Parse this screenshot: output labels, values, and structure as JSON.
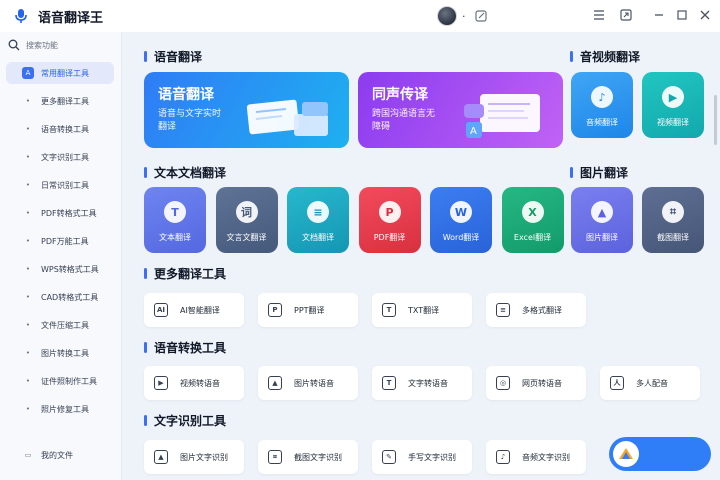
{
  "app": {
    "title": "语音翻译王",
    "user_name": "."
  },
  "sidebar": {
    "search_placeholder": "搜索功能",
    "items": [
      {
        "label": "常用翻译工具",
        "icon": "translate-icon"
      },
      {
        "label": "更多翻译工具",
        "icon": "more-translate-icon"
      },
      {
        "label": "语音转换工具",
        "icon": "voice-icon"
      },
      {
        "label": "文字识别工具",
        "icon": "text-recognition-icon"
      },
      {
        "label": "日常识别工具",
        "icon": "daily-recognition-icon"
      },
      {
        "label": "PDF转格式工具",
        "icon": "pdf-convert-icon"
      },
      {
        "label": "PDF万能工具",
        "icon": "pdf-tools-icon"
      },
      {
        "label": "WPS转格式工具",
        "icon": "wps-icon"
      },
      {
        "label": "CAD转格式工具",
        "icon": "cad-icon"
      },
      {
        "label": "文件压缩工具",
        "icon": "compress-icon"
      },
      {
        "label": "图片转换工具",
        "icon": "image-convert-icon"
      },
      {
        "label": "证件照制作工具",
        "icon": "id-photo-icon"
      },
      {
        "label": "照片修复工具",
        "icon": "photo-repair-icon"
      }
    ],
    "my_files": "我的文件"
  },
  "sections": {
    "voice_translate": "语音翻译",
    "av_translate": "音视频翻译",
    "doc_translate": "文本文档翻译",
    "image_translate": "图片翻译",
    "more_tools": "更多翻译工具",
    "voice_convert": "语音转换工具",
    "ocr_tools": "文字识别工具"
  },
  "banners": [
    {
      "title": "语音翻译",
      "subtitle_line1": "语音与文字实时",
      "subtitle_line2": "翻译",
      "color_from": "#2f7cf6",
      "color_to": "#1fb0f0"
    },
    {
      "title": "同声传译",
      "subtitle_line1": "跨国沟通语言无",
      "subtitle_line2": "障碍",
      "color_from": "#8b3cf0",
      "color_to": "#c062f5"
    }
  ],
  "av_tiles": [
    {
      "label": "音频翻译",
      "glyph": "♪",
      "color_from": "#3fa6f5",
      "color_to": "#1e86e8"
    },
    {
      "label": "视频翻译",
      "glyph": "▶",
      "color_from": "#21c6c0",
      "color_to": "#12a8ad"
    }
  ],
  "doc_tiles": [
    {
      "label": "文本翻译",
      "glyph": "T",
      "color_from": "#6f84f0",
      "color_to": "#5468e0"
    },
    {
      "label": "文言文翻译",
      "glyph": "词",
      "color_from": "#5f7396",
      "color_to": "#45597c"
    },
    {
      "label": "文档翻译",
      "glyph": "≡",
      "color_from": "#27b8ce",
      "color_to": "#1596b2"
    },
    {
      "label": "PDF翻译",
      "glyph": "P",
      "color_from": "#f24b5c",
      "color_to": "#d9303f"
    },
    {
      "label": "Word翻译",
      "glyph": "W",
      "color_from": "#3c7df2",
      "color_to": "#2963d8"
    },
    {
      "label": "Excel翻译",
      "glyph": "X",
      "color_from": "#25b884",
      "color_to": "#139b6a"
    }
  ],
  "image_tiles": [
    {
      "label": "图片翻译",
      "glyph": "▲",
      "color_from": "#7a7ff0",
      "color_to": "#5c62dc"
    },
    {
      "label": "截图翻译",
      "glyph": "⌗",
      "color_from": "#5f6f94",
      "color_to": "#465677"
    }
  ],
  "more_tools": [
    {
      "label": "AI智能翻译",
      "glyph": "AI"
    },
    {
      "label": "PPT翻译",
      "glyph": "P"
    },
    {
      "label": "TXT翻译",
      "glyph": "T"
    },
    {
      "label": "多格式翻译",
      "glyph": "≡"
    }
  ],
  "voice_tools": [
    {
      "label": "视频转语音",
      "glyph": "▶"
    },
    {
      "label": "图片转语音",
      "glyph": "▲"
    },
    {
      "label": "文字转语音",
      "glyph": "T"
    },
    {
      "label": "网页转语音",
      "glyph": "◎"
    },
    {
      "label": "多人配音",
      "glyph": "人"
    }
  ],
  "ocr_tools": [
    {
      "label": "图片文字识别",
      "glyph": "▲"
    },
    {
      "label": "截图文字识别",
      "glyph": "⌗"
    },
    {
      "label": "手写文字识别",
      "glyph": "✎"
    },
    {
      "label": "音频文字识别",
      "glyph": "♪"
    }
  ],
  "colors": {
    "accent": "#3b6ff5",
    "background": "#eef2f9"
  }
}
